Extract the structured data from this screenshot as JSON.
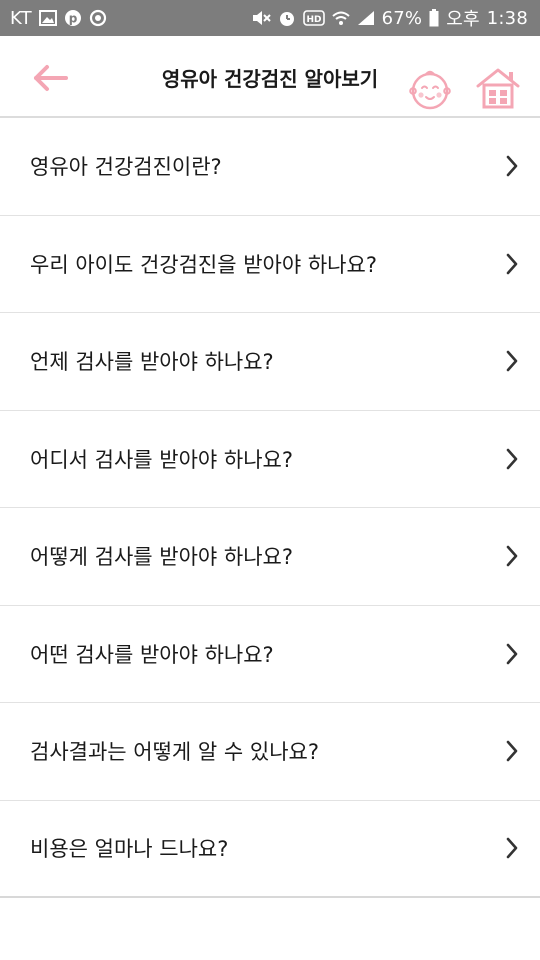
{
  "status_bar": {
    "carrier": "KT",
    "battery_percent": "67%",
    "time_prefix": "오후",
    "time": "1:38",
    "hd_label": "HD"
  },
  "header": {
    "title": "영유아 건강검진 알아보기"
  },
  "colors": {
    "accent_pink": "#f4a6b4",
    "status_bar_bg": "#7d7d7d"
  },
  "faq": {
    "items": [
      {
        "label": "영유아 건강검진이란?"
      },
      {
        "label": "우리 아이도 건강검진을 받아야 하나요?"
      },
      {
        "label": "언제 검사를 받아야 하나요?"
      },
      {
        "label": "어디서 검사를 받아야 하나요?"
      },
      {
        "label": "어떻게 검사를 받아야 하나요?"
      },
      {
        "label": "어떤 검사를 받아야 하나요?"
      },
      {
        "label": "검사결과는 어떻게 알 수 있나요?"
      },
      {
        "label": "비용은 얼마나 드나요?"
      }
    ]
  },
  "icons": {
    "back": "arrow-left-icon",
    "baby": "baby-face-icon",
    "home": "home-icon",
    "chevron": "chevron-right-icon"
  }
}
